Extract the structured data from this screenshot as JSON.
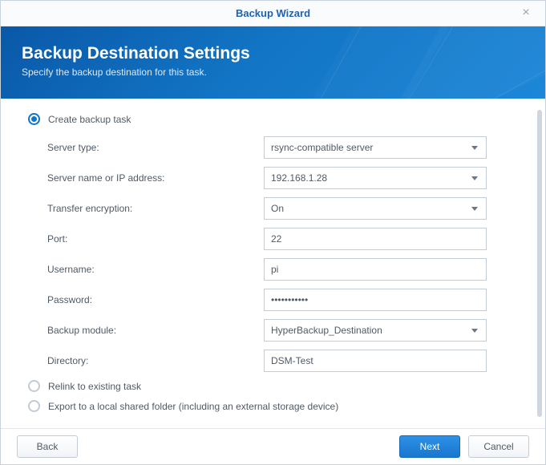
{
  "titlebar": {
    "title": "Backup Wizard"
  },
  "banner": {
    "heading": "Backup Destination Settings",
    "subheading": "Specify the backup destination for this task."
  },
  "options": {
    "create_label": "Create backup task",
    "relink_label": "Relink to existing task",
    "export_label": "Export to a local shared folder (including an external storage device)"
  },
  "form": {
    "server_type_label": "Server type:",
    "server_type_value": "rsync-compatible server",
    "server_name_label": "Server name or IP address:",
    "server_name_value": "192.168.1.28",
    "encryption_label": "Transfer encryption:",
    "encryption_value": "On",
    "port_label": "Port:",
    "port_value": "22",
    "username_label": "Username:",
    "username_value": "pi",
    "password_label": "Password:",
    "password_value": "•••••••••••",
    "module_label": "Backup module:",
    "module_value": "HyperBackup_Destination",
    "directory_label": "Directory:",
    "directory_value": "DSM-Test"
  },
  "footer": {
    "back": "Back",
    "next": "Next",
    "cancel": "Cancel"
  }
}
